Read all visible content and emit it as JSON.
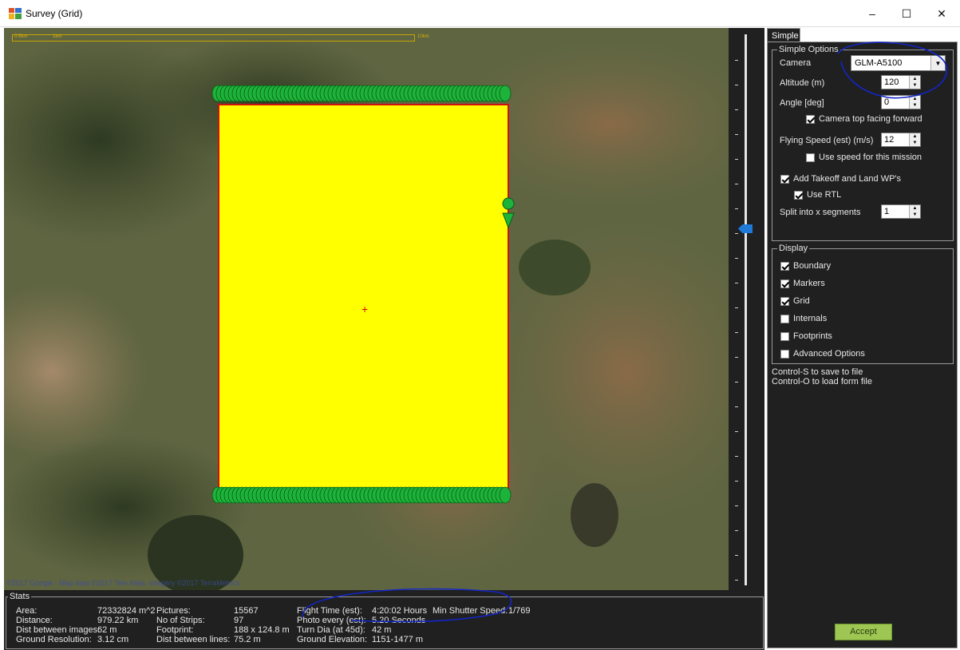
{
  "window": {
    "title": "Survey (Grid)",
    "minimize": "–",
    "maximize": "☐",
    "close": "✕"
  },
  "map": {
    "scale_label_1": "0.5km",
    "scale_label_2": "1km",
    "scale_label_end": "10km",
    "copyright": "©2017 Google - Map data ©2017 Tele Atlas, Imagery ©2017 TerraMetrics"
  },
  "stats": {
    "legend": "Stats",
    "area_label": "Area:",
    "area_value": "72332824 m^2",
    "distance_label": "Distance:",
    "distance_value": "979.22 km",
    "dist_images_label": "Dist between images:",
    "dist_images_value": "62 m",
    "ground_res_label": "Ground Resolution:",
    "ground_res_value": "3.12 cm",
    "pictures_label": "Pictures:",
    "pictures_value": "15567",
    "strips_label": "No of Strips:",
    "strips_value": "97",
    "footprint_label": "Footprint:",
    "footprint_value": "188 x 124.8 m",
    "dist_lines_label": "Dist between lines:",
    "dist_lines_value": "75.2 m",
    "flight_time_label": "Flight Time (est):",
    "flight_time_value": "4:20:02 Hours",
    "photo_every_label": "Photo every (est):",
    "photo_every_value": "5.20 Seconds",
    "turn_dia_label": "Turn Dia (at 45d):",
    "turn_dia_value": "42 m",
    "ground_elev_label": "Ground Elevation:",
    "ground_elev_value": "1151-1477 m",
    "shutter_label": "Min Shutter Speed:",
    "shutter_value": "1/769"
  },
  "tabs": {
    "simple": "Simple"
  },
  "simple_options": {
    "legend": "Simple Options",
    "camera_label": "Camera",
    "camera_value": "GLM-A5100",
    "altitude_label": "Altitude (m)",
    "altitude_value": "120",
    "angle_label": "Angle [deg]",
    "angle_value": "0",
    "camera_top_label": "Camera top facing forward",
    "camera_top_checked": true,
    "speed_label": "Flying Speed (est) (m/s)",
    "speed_value": "12",
    "use_speed_label": "Use speed for this mission",
    "use_speed_checked": false,
    "takeoff_label": "Add Takeoff and Land WP's",
    "takeoff_checked": true,
    "rtl_label": "Use RTL",
    "rtl_checked": true,
    "split_label": "Split into x segments",
    "split_value": "1"
  },
  "display": {
    "legend": "Display",
    "boundary_label": "Boundary",
    "boundary_checked": true,
    "markers_label": "Markers",
    "markers_checked": true,
    "grid_label": "Grid",
    "grid_checked": true,
    "internals_label": "Internals",
    "internals_checked": false,
    "footprints_label": "Footprints",
    "footprints_checked": false,
    "advanced_label": "Advanced Options",
    "advanced_checked": false
  },
  "hints": {
    "save": "Control-S to save to file",
    "load": "Control-O to load form file"
  },
  "accept_label": "Accept",
  "colors": {
    "survey_fill": "#ffff00",
    "survey_border": "#d01010",
    "marker": "#1db33a",
    "panel_bg": "#202020",
    "accept_bg": "#9dc752",
    "zoom_thumb": "#1f79d6",
    "annotation": "#1226c8"
  }
}
